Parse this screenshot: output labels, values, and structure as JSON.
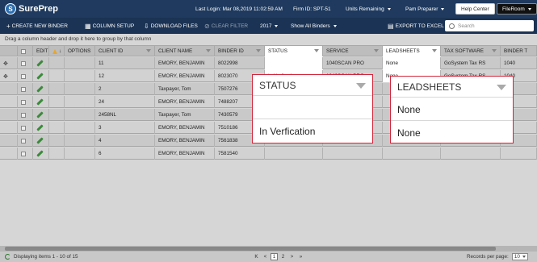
{
  "header": {
    "logo_text": "SurePrep",
    "last_login": "Last Login: Mar 08,2019 11:02:59 AM",
    "firm_id": "Firm ID: SPT-51",
    "units_remaining": "Units Remaining",
    "user_menu": "Pam Preparer",
    "help_center": "Help Center",
    "fileroom": "FileRoom"
  },
  "toolbar": {
    "create_binder": "CREATE NEW BINDER",
    "column_setup": "COLUMN SETUP",
    "download_files": "DOWNLOAD FILES",
    "clear_filter": "CLEAR FILTER",
    "year": "2017",
    "binder_filter": "Show All Binders",
    "export": "EXPORT TO EXCEL",
    "search_placeholder": "Search"
  },
  "grid": {
    "group_hint": "Drag a column header and drop it here to group by that column",
    "columns": {
      "edit": "EDIT",
      "options": "OPTIONS",
      "client_id": "CLIENT ID",
      "client_name": "CLIENT NAME",
      "binder_id": "BINDER ID",
      "status": "STATUS",
      "service": "SERVICE",
      "leadsheets": "LEADSHEETS",
      "tax_software": "TAX SOFTWARE",
      "binder_type": "BINDER T"
    },
    "rows": [
      {
        "client_id": "11",
        "client_name": "EMORY, BENJAMIN",
        "binder_id": "8022998",
        "status": "",
        "service": "1040SCAN PRO",
        "leadsheets": "None",
        "tax_software": "GoSystem Tax RS",
        "binder_type": "1040"
      },
      {
        "client_id": "12",
        "client_name": "EMORY, BENJAMIN",
        "binder_id": "8023070",
        "status": "In Verfication",
        "service": "1040SCAN PRO",
        "leadsheets": "None",
        "tax_software": "GoSystem Tax RS",
        "binder_type": "1040"
      },
      {
        "client_id": "2",
        "client_name": "Taxpayer, Tom",
        "binder_id": "7507276",
        "status": "",
        "service": "",
        "leadsheets": "",
        "tax_software": "",
        "binder_type": ""
      },
      {
        "client_id": "24",
        "client_name": "EMORY, BENJAMIN",
        "binder_id": "7488207",
        "status": "",
        "service": "",
        "leadsheets": "",
        "tax_software": "",
        "binder_type": ""
      },
      {
        "client_id": "2458NL",
        "client_name": "Taxpayer, Tom",
        "binder_id": "7430579",
        "status": "",
        "service": "",
        "leadsheets": "",
        "tax_software": "",
        "binder_type": ""
      },
      {
        "client_id": "3",
        "client_name": "EMORY, BENJAMIN",
        "binder_id": "7510186",
        "status": "",
        "service": "",
        "leadsheets": "",
        "tax_software": "",
        "binder_type": ""
      },
      {
        "client_id": "4",
        "client_name": "EMORY, BENJAMIN",
        "binder_id": "7561838",
        "status": "",
        "service": "",
        "leadsheets": "",
        "tax_software": "",
        "binder_type": ""
      },
      {
        "client_id": "6",
        "client_name": "EMORY, BENJAMIN",
        "binder_id": "7581540",
        "status": "",
        "service": "",
        "leadsheets": "",
        "tax_software": "",
        "binder_type": ""
      }
    ]
  },
  "footer": {
    "displaying": "Displaying items 1 - 10 of 15",
    "page_first": "K",
    "page_prev": "<",
    "page_1": "1",
    "page_2": "2",
    "page_next": ">",
    "page_last": "»",
    "records_per_page": "Records per page:",
    "page_size": "10"
  },
  "callouts": {
    "status": {
      "header": "STATUS",
      "rows": [
        "",
        "In Verfication"
      ]
    },
    "leadsheets": {
      "header": "LEADSHEETS",
      "rows": [
        "None",
        "None"
      ]
    }
  }
}
